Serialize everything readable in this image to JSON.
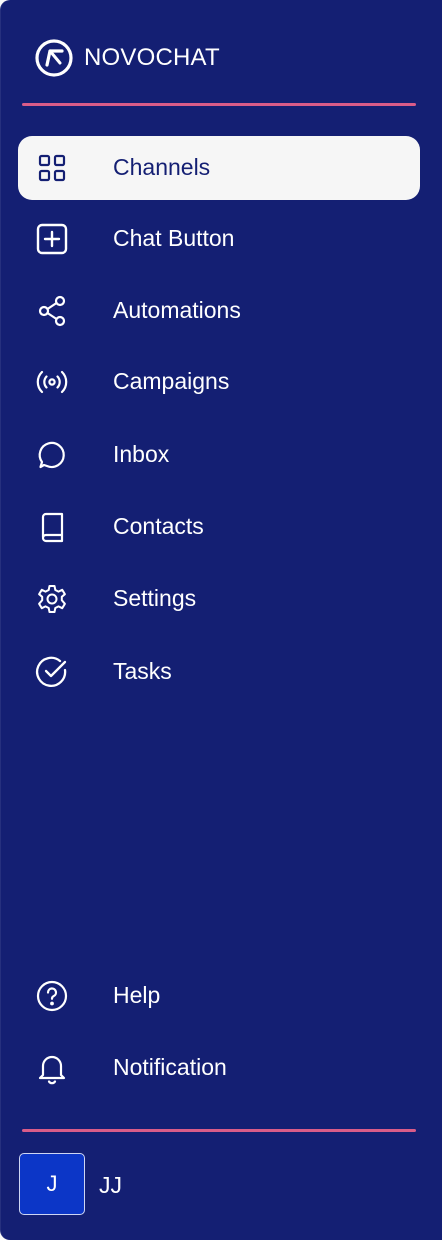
{
  "brand": {
    "name": "NOVOCHAT",
    "logo_icon": "novochat-logo-icon"
  },
  "nav": {
    "items": [
      {
        "label": "Channels",
        "icon": "grid-icon",
        "active": true
      },
      {
        "label": "Chat Button",
        "icon": "plus-square-icon",
        "active": false
      },
      {
        "label": "Automations",
        "icon": "share-icon",
        "active": false
      },
      {
        "label": "Campaigns",
        "icon": "broadcast-icon",
        "active": false
      },
      {
        "label": "Inbox",
        "icon": "chat-bubble-icon",
        "active": false
      },
      {
        "label": "Contacts",
        "icon": "book-icon",
        "active": false
      },
      {
        "label": "Settings",
        "icon": "gear-icon",
        "active": false
      },
      {
        "label": "Tasks",
        "icon": "check-circle-icon",
        "active": false
      }
    ],
    "footer_items": [
      {
        "label": "Help",
        "icon": "help-circle-icon"
      },
      {
        "label": "Notification",
        "icon": "bell-icon"
      }
    ]
  },
  "profile": {
    "initial": "J",
    "name": "JJ"
  },
  "colors": {
    "sidebar_bg": "#141f73",
    "accent_divider": "#d95c89",
    "active_bg": "#f6f6f6",
    "avatar_bg": "#0c36c7"
  }
}
